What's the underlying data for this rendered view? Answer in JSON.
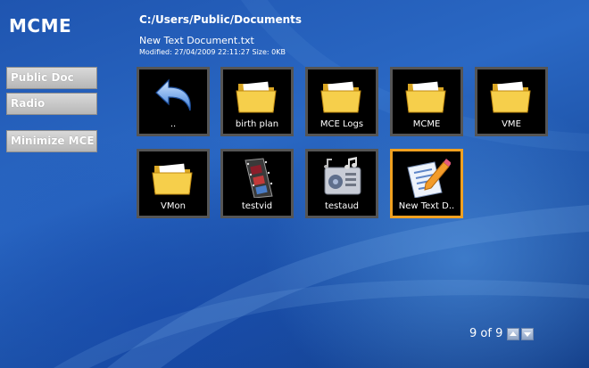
{
  "app": {
    "title": "MCME"
  },
  "sidebar": {
    "buttons": [
      {
        "label": "Public Doc"
      },
      {
        "label": "Radio"
      },
      {
        "label": "Minimize MCE"
      }
    ]
  },
  "header": {
    "path": "C:/Users/Public/Documents",
    "selected_name": "New Text Document.txt",
    "selected_meta": "Modified: 27/04/2009 22:11:27 Size: 0KB"
  },
  "items": [
    {
      "label": "..",
      "icon": "back-arrow-icon"
    },
    {
      "label": "birth plan",
      "icon": "folder-icon"
    },
    {
      "label": "MCE Logs",
      "icon": "folder-icon"
    },
    {
      "label": "MCME",
      "icon": "folder-icon"
    },
    {
      "label": "VME",
      "icon": "folder-icon"
    },
    {
      "label": "VMon",
      "icon": "folder-icon"
    },
    {
      "label": "testvid",
      "icon": "video-file-icon"
    },
    {
      "label": "testaud",
      "icon": "audio-file-icon"
    },
    {
      "label": "New Text D..",
      "icon": "text-document-icon",
      "selected": true
    }
  ],
  "pager": {
    "text": "9 of 9"
  }
}
